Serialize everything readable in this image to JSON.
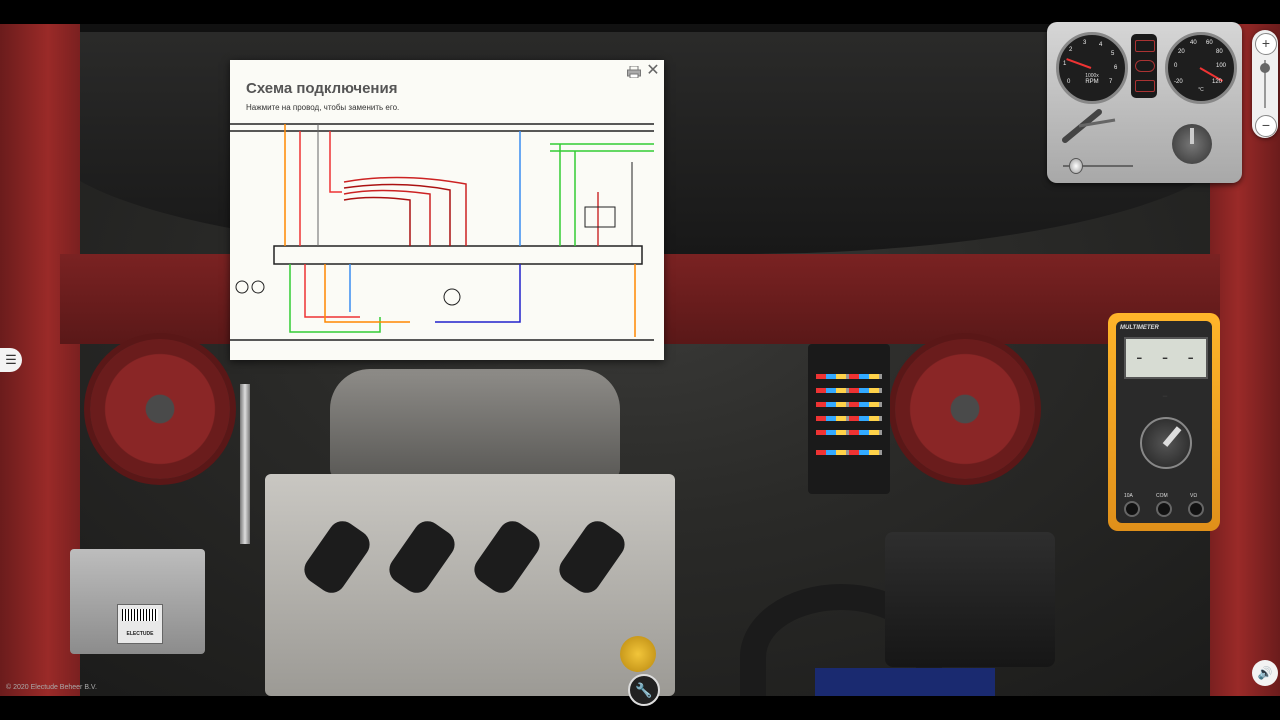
{
  "dialog": {
    "title": "Схема подключения",
    "subtitle": "Нажмите на провод, чтобы заменить его."
  },
  "dashboard": {
    "rpm": {
      "unit": "1000x",
      "label": "RPM",
      "ticks": [
        "0",
        "1",
        "2",
        "3",
        "4",
        "5",
        "6",
        "7"
      ]
    },
    "temp": {
      "unit": "°C",
      "ticks": [
        "-20",
        "0",
        "20",
        "40",
        "60",
        "80",
        "100",
        "120"
      ]
    }
  },
  "multimeter": {
    "label": "MULTIMETER",
    "display": "- - - -",
    "jacks": [
      "10A",
      "COM",
      "VΩ"
    ]
  },
  "ecu": {
    "brand": "ELECTUDE"
  },
  "footer": {
    "copyright": "© 2020 Electude Beheer B.V."
  },
  "icons": {
    "menu": "menu-icon",
    "sound": "speaker-icon",
    "tool": "wrench-icon",
    "print": "print-icon",
    "close": "close-icon"
  },
  "colors": {
    "accent": "#e0901a",
    "dialog_bg": "#fbfbf6",
    "car_red": "#8a2626"
  }
}
